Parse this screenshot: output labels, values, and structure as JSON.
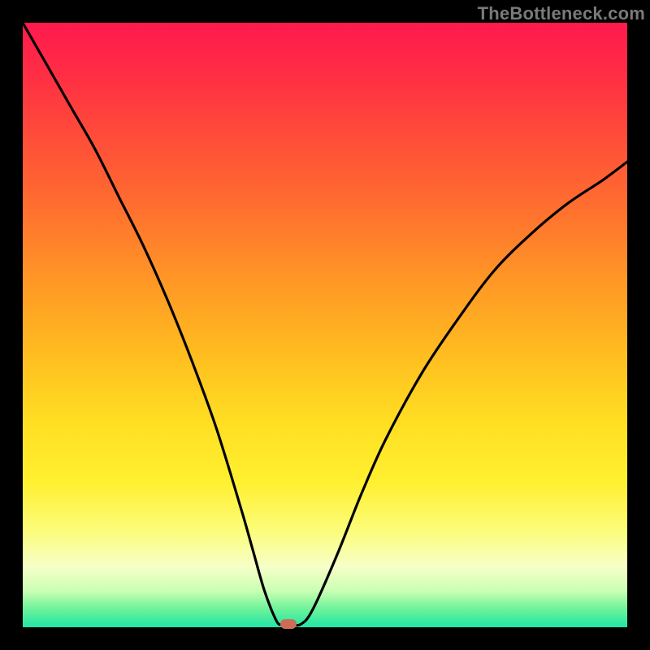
{
  "watermark": "TheBottleneck.com",
  "colors": {
    "frame": "#000000",
    "curve": "#000000",
    "marker": "#cc6d5a",
    "gradient_stops": [
      "#ff1a4d",
      "#ff6d2f",
      "#ffde22",
      "#f6ffc7",
      "#1fe6a6"
    ]
  },
  "chart_data": {
    "type": "line",
    "title": "",
    "xlabel": "",
    "ylabel": "",
    "xlim": [
      0,
      100
    ],
    "ylim": [
      0,
      100
    ],
    "x": [
      0,
      4,
      8,
      12,
      16,
      20,
      24,
      28,
      32,
      36,
      38,
      40,
      42,
      43,
      44,
      46,
      48,
      52,
      56,
      60,
      66,
      72,
      78,
      84,
      90,
      96,
      100
    ],
    "values": [
      100,
      93,
      86,
      79,
      71,
      63,
      54,
      44,
      33,
      20,
      13,
      6,
      1,
      0.5,
      0.5,
      0.5,
      3,
      12,
      22,
      31,
      42,
      51,
      59,
      65,
      70,
      74,
      77
    ],
    "marker": {
      "x": 44,
      "y": 0.5
    },
    "note": "x and values are in percent of the plot area; a V-shaped bottleneck curve with minimum near x≈44."
  }
}
